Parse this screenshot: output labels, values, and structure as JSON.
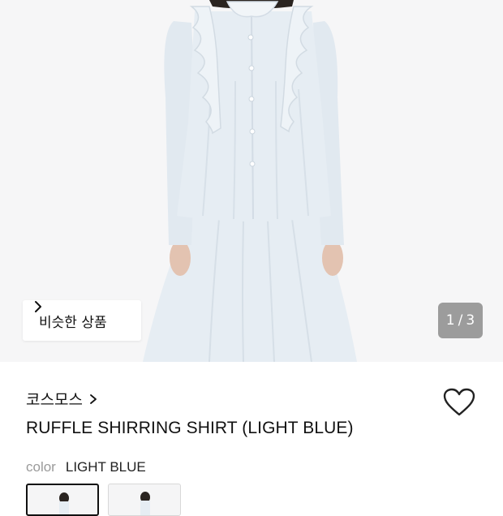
{
  "hero": {
    "image": "product-photo-ruffle-shirt-light-blue",
    "similar_label": "비슷한 상품",
    "counter": {
      "current": "1",
      "separator": "/",
      "total": "3"
    }
  },
  "product": {
    "brand": "코스모스",
    "title": "RUFFLE SHIRRING SHIRT (LIGHT BLUE)",
    "color_key": "color",
    "color_value": "LIGHT BLUE"
  },
  "thumbnails": [
    {
      "name": "thumbnail-1",
      "selected": true
    },
    {
      "name": "thumbnail-2",
      "selected": false
    }
  ],
  "colors": {
    "garment": "#e3ebf1",
    "accent_text": "#111111",
    "muted_text": "#9a9a9a"
  }
}
